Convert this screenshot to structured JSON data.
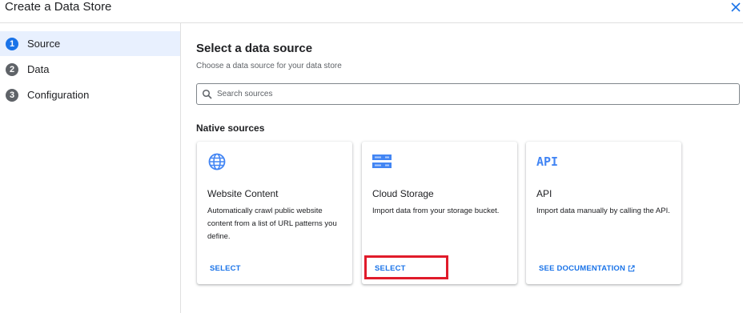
{
  "window": {
    "title": "Create a Data Store"
  },
  "steps": [
    {
      "num": "1",
      "label": "Source"
    },
    {
      "num": "2",
      "label": "Data"
    },
    {
      "num": "3",
      "label": "Configuration"
    }
  ],
  "main": {
    "heading": "Select a data source",
    "subheading": "Choose a data source for your data store",
    "search": {
      "placeholder": "Search sources"
    },
    "section_title": "Native sources",
    "cards": [
      {
        "icon": "globe-icon",
        "title": "Website Content",
        "description": "Automatically crawl public website content from a list of URL patterns you define.",
        "action": "SELECT"
      },
      {
        "icon": "storage-icon",
        "title": "Cloud Storage",
        "description": "Import data from your storage bucket.",
        "action": "SELECT"
      },
      {
        "icon": "api-icon",
        "icon_text": "API",
        "title": "API",
        "description": "Import data manually by calling the API.",
        "action": "SEE DOCUMENTATION"
      }
    ]
  },
  "colors": {
    "accent": "#1a73e8",
    "highlight": "#e01b2a",
    "icon": "#4285f4"
  }
}
